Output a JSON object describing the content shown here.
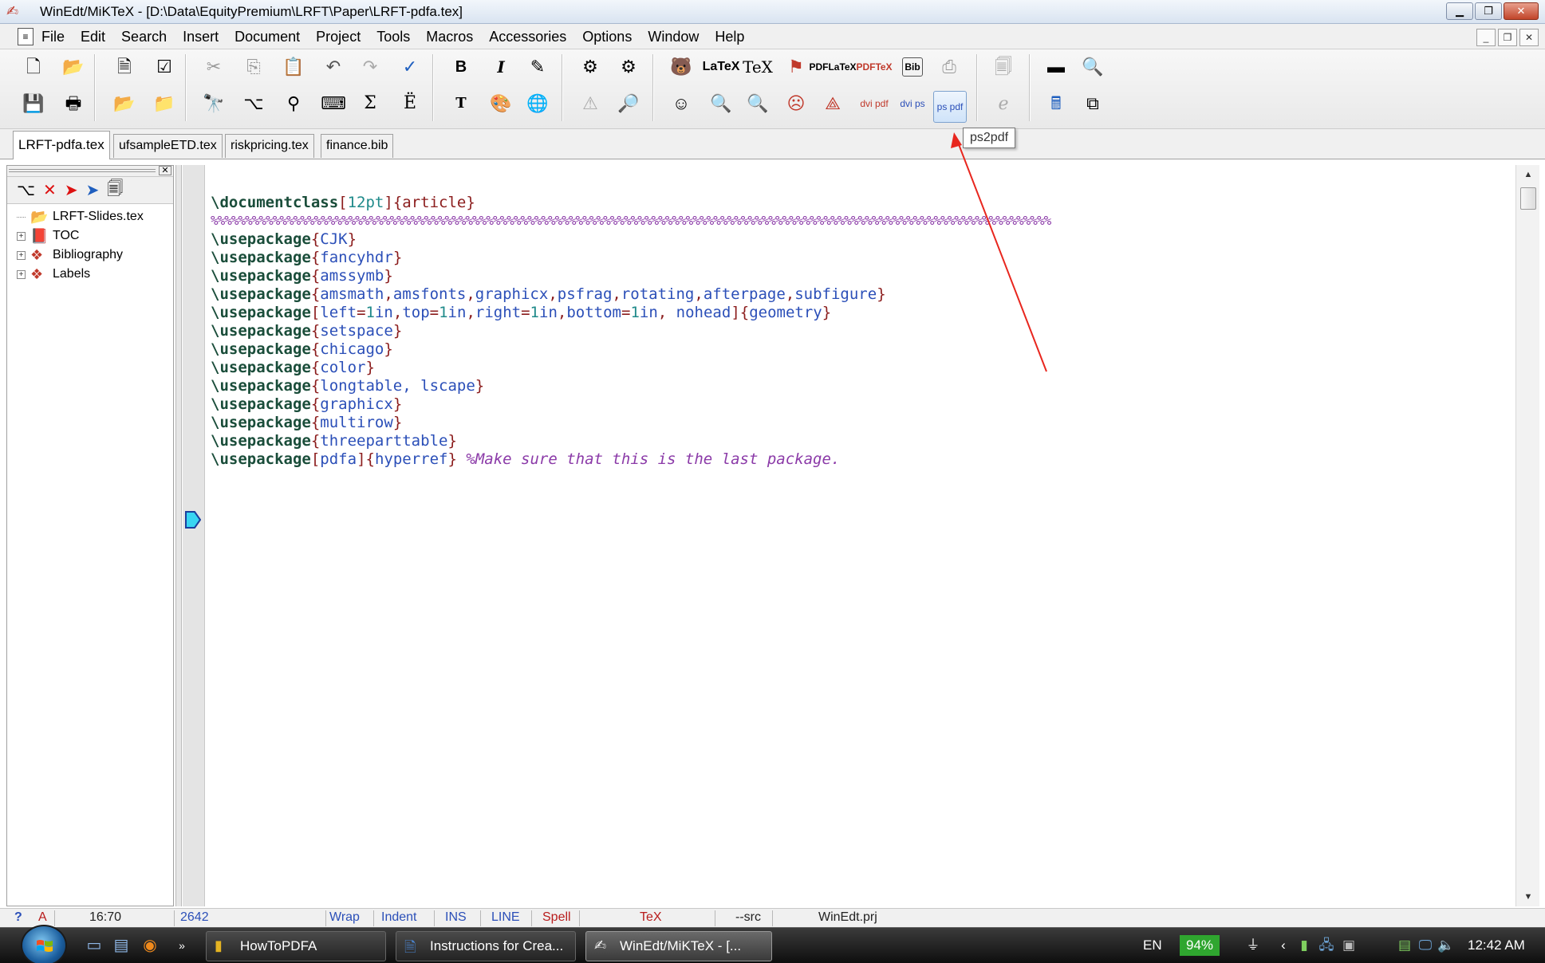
{
  "window": {
    "title": "WinEdt/MiKTeX - [D:\\Data\\EquityPremium\\LRFT\\Paper\\LRFT-pdfa.tex]"
  },
  "menu": [
    "File",
    "Edit",
    "Search",
    "Insert",
    "Document",
    "Project",
    "Tools",
    "Macros",
    "Accessories",
    "Options",
    "Window",
    "Help"
  ],
  "toolbar": {
    "latex_label": "LaTeX",
    "tex_label": "TeX",
    "pdflatex_label": "PDFLaTeX",
    "pdftex_label": "PDFTeX",
    "bibtex_label": "Bib",
    "dvipdf_label": "dvi pdf",
    "dvips_label": "dvi ps",
    "ps2pdf_label": "ps pdf",
    "bold_label": "B",
    "italic_label": "I",
    "typewriter_label": "T",
    "sigma_label": "Σ",
    "accent_label": "Ë"
  },
  "tooltip": "ps2pdf",
  "tabs": [
    {
      "label": "LRFT-pdfa.tex",
      "active": true
    },
    {
      "label": "ufsampleETD.tex",
      "active": false
    },
    {
      "label": "riskpricing.tex",
      "active": false
    },
    {
      "label": "finance.bib",
      "active": false
    }
  ],
  "tree": [
    {
      "label": "LRFT-Slides.tex",
      "icon": "tex-file-icon",
      "expandable": false
    },
    {
      "label": "TOC",
      "icon": "book-icon",
      "expandable": true
    },
    {
      "label": "Bibliography",
      "icon": "bibliography-icon",
      "expandable": true
    },
    {
      "label": "Labels",
      "icon": "labels-icon",
      "expandable": true
    }
  ],
  "code": {
    "line1": {
      "cmd": "\\documentclass",
      "opt": "12pt",
      "arg": "article"
    },
    "line2": "%%%%%%%%%%%%%%%%%%%%%%%%%%%%%%%%%%%%%%%%%%%%%%%%%%%%%%%%%%%%%%%%%%%%%%%%%%%%%%%%%%%%%%%%%%%%%%%%%%%%%%%%%%%%%%%%%%%%%%%%%%",
    "usepackage": "\\usepackage",
    "pkg_cjk": "CJK",
    "pkg_fancyhdr": "fancyhdr",
    "pkg_amssymb": "amssymb",
    "pkg_multi": [
      "amsmath",
      "amsfonts",
      "graphicx",
      "psfrag",
      "rotating",
      "afterpage",
      "subfigure"
    ],
    "geometry_opts": [
      {
        "key": "left",
        "val": "1",
        "unit": "in"
      },
      {
        "key": "top",
        "val": "1",
        "unit": "in"
      },
      {
        "key": "right",
        "val": "1",
        "unit": "in"
      },
      {
        "key": "bottom",
        "val": "1",
        "unit": "in"
      }
    ],
    "geometry_extra": " nohead",
    "pkg_geometry": "geometry",
    "pkg_setspace": "setspace",
    "pkg_chicago": "chicago",
    "pkg_color": "color",
    "pkg_longtable": "longtable, lscape",
    "pkg_graphicx": "graphicx",
    "pkg_multirow": "multirow",
    "pkg_threeparttable": "threeparttable",
    "hyperref_opt": "pdfa",
    "pkg_hyperref": "hyperref",
    "hyperref_comment": "%Make sure that this is the last package."
  },
  "status": {
    "help": "?",
    "mode_a": "A",
    "position": "16:70",
    "count": "2642",
    "wrap": "Wrap",
    "indent": "Indent",
    "ins": "INS",
    "line": "LINE",
    "spell": "Spell",
    "tex": "TeX",
    "src": "--src",
    "project": "WinEdt.prj"
  },
  "taskbar": {
    "tasks": [
      "HowToPDFA",
      "Instructions for Crea...",
      "WinEdt/MiKTeX - [..."
    ],
    "lang": "EN",
    "battery": "94%",
    "time": "12:42 AM"
  }
}
